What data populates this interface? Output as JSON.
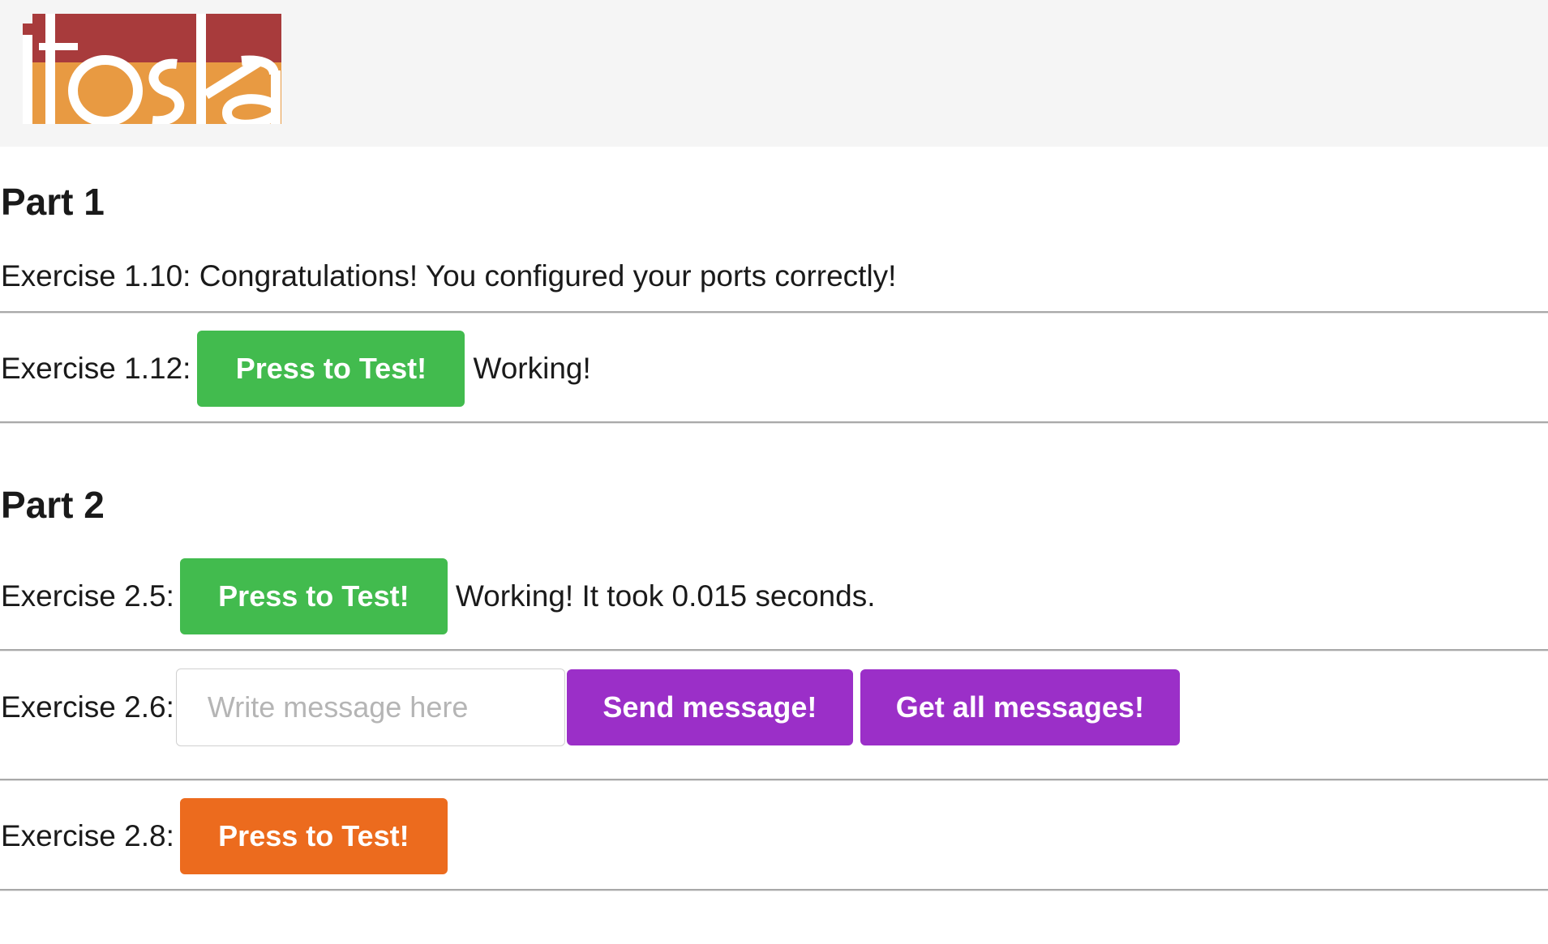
{
  "header": {
    "logo_text": "itoska",
    "colors": {
      "background": "#f5f5f5",
      "logo_dark": "#a83b3c",
      "logo_light": "#e89a42"
    }
  },
  "part1": {
    "title": "Part 1",
    "ex_1_10": {
      "label": "Exercise 1.10:",
      "message": "Congratulations! You configured your ports correctly!"
    },
    "ex_1_12": {
      "label": "Exercise 1.12:",
      "button": "Press to Test!",
      "status": "Working!"
    }
  },
  "part2": {
    "title": "Part 2",
    "ex_2_5": {
      "label": "Exercise 2.5:",
      "button": "Press to Test!",
      "status": "Working! It took 0.015 seconds."
    },
    "ex_2_6": {
      "label": "Exercise 2.6:",
      "input_placeholder": "Write message here",
      "input_value": "",
      "send_button": "Send message!",
      "get_button": "Get all messages!"
    },
    "ex_2_8": {
      "label": "Exercise 2.8:",
      "button": "Press to Test!"
    }
  },
  "colors": {
    "success_green": "#42bb4e",
    "pending_orange": "#ec6b1e",
    "action_purple": "#9b2fc8"
  }
}
